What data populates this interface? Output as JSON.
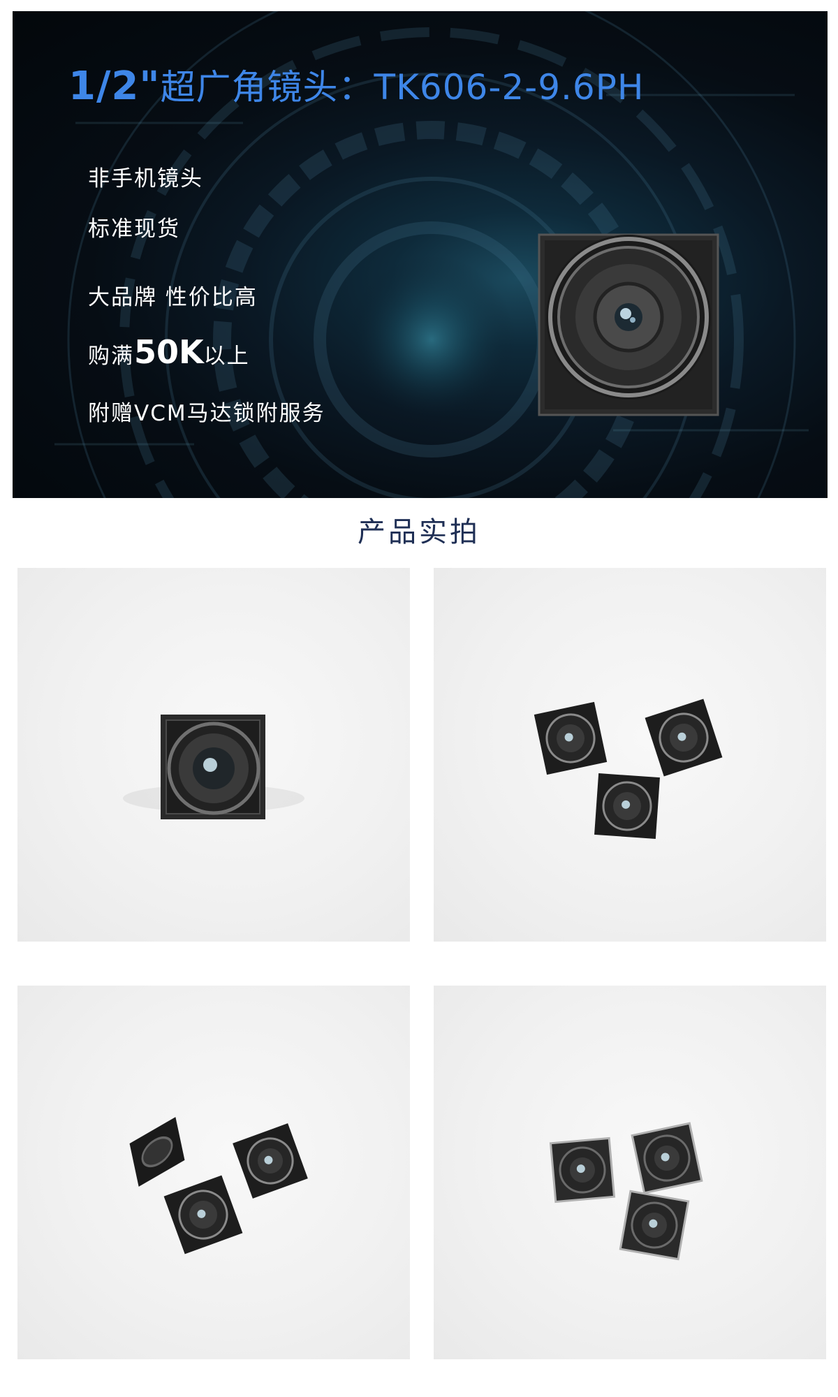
{
  "banner": {
    "title_size": "1/2\"",
    "title_rest": "超广角镜头：TK606-2-9.6PH",
    "features": [
      "非手机镜头",
      "标准现货",
      "大品牌 性价比高"
    ],
    "promo_prefix": "购满",
    "promo_amount": "50K",
    "promo_suffix": "以上",
    "service": "附赠VCM马达锁附服务"
  },
  "section": {
    "title": "产品实拍"
  },
  "colors": {
    "title_blue": "#3e86e8",
    "section_title": "#1f2f55",
    "banner_dark": "#060d14"
  }
}
